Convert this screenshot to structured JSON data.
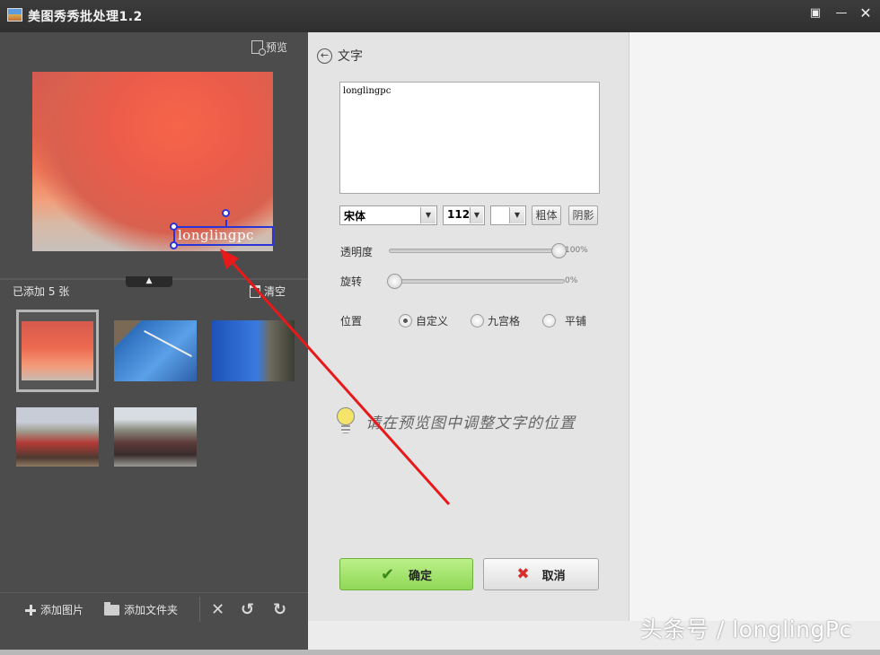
{
  "window": {
    "title": "美图秀秀批处理1.2",
    "controls": [
      "feedback",
      "minimize",
      "close"
    ]
  },
  "left": {
    "preview_label": "预览",
    "overlay_text": "longlingpc",
    "added_count": "已添加 5 张",
    "clear_label": "清空",
    "toolbar": {
      "add_image": "添加图片",
      "add_folder": "添加文件夹"
    }
  },
  "panel": {
    "back_label": "文字",
    "text_value": "longlingpc",
    "font_name": "宋体",
    "font_size": "112",
    "bold_label": "粗体",
    "shadow_label": "阴影",
    "opacity_label": "透明度",
    "opacity_value": "100%",
    "opacity_fraction": 1.0,
    "rotate_label": "旋转",
    "rotate_value": "0%",
    "rotate_fraction": 0.0,
    "position_label": "位置",
    "position_options": [
      "自定义",
      "九宫格",
      "平铺"
    ],
    "position_selected": "自定义",
    "hint": "请在预览图中调整文字的位置",
    "ok_label": "确定",
    "cancel_label": "取消"
  },
  "watermark": "头条号 / longlingPc",
  "colors": {
    "annotation_arrow": "#e8191b",
    "selection_box": "#2a35d8",
    "ok_button": "#8fd856",
    "cancel_icon": "#d82d2d"
  }
}
